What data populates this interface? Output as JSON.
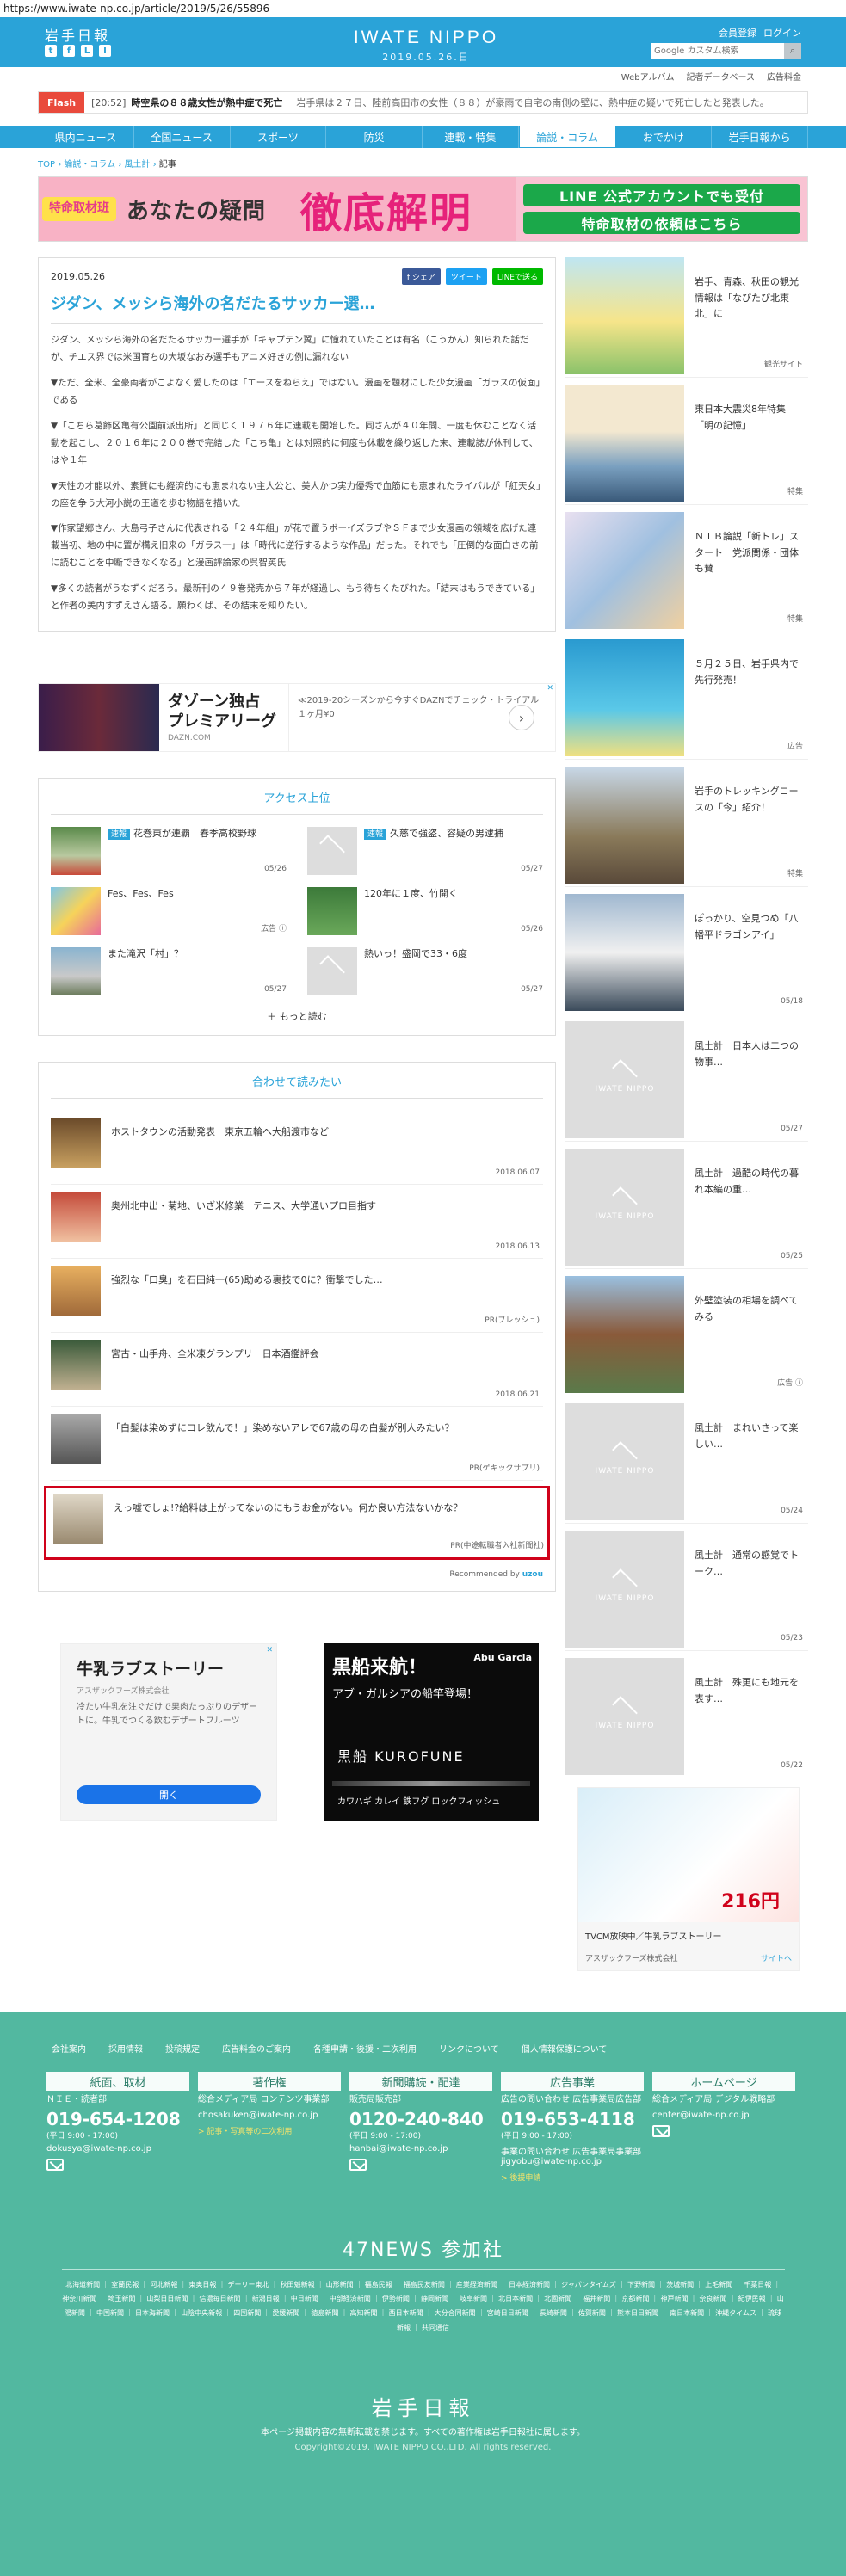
{
  "url": "https://www.iwate-np.co.jp/article/2019/5/26/55896",
  "header": {
    "logo_small": "岩手日報",
    "brand_name": "IWATE NIPPO",
    "date": "2019.05.26.日",
    "links": [
      "会員登録",
      "ログイン"
    ],
    "search_placeholder": "Google カスタム検索",
    "social": [
      "t",
      "f",
      "L",
      "I"
    ]
  },
  "subnav": [
    "Webアルバム",
    "記者データベース",
    "広告料金"
  ],
  "flash": {
    "tag": "Flash",
    "time": "[20:52]",
    "headline": "時空県の８８歳女性が熱中症で死亡",
    "body": "岩手県は２７日、陸前高田市の女性（８８）が豪雨で自宅の南側の壁に、熱中症の疑いで死亡したと発表した。"
  },
  "mainnav": [
    "県内ニュース",
    "全国ニュース",
    "スポーツ",
    "防災",
    "連載・特集",
    "論説・コラム",
    "おでかけ",
    "岩手日報から"
  ],
  "breadcrumb": [
    "TOP",
    "論説・コラム",
    "風土計",
    "記事"
  ],
  "banner": {
    "b1": "特命取材班",
    "b2": "あなたの疑問",
    "b3": "徹底解明",
    "r1": "LINE 公式アカウントでも受付",
    "r2": "特命取材の依頼はこちら"
  },
  "article": {
    "date": "2019.05.26",
    "shares": [
      "f シェア",
      "ツイート",
      "LINEで送る"
    ],
    "title": "ジダン、メッシら海外の名だたるサッカー選…",
    "paragraphs": [
      "ジダン、メッシら海外の名だたるサッカー選手が「キャプテン翼」に憧れていたことは有名（こうかん）知られた話だが、チエス界では米国育ちの大坂なおみ選手もアニメ好きの例に漏れない",
      "▼ただ、全米、全豪両者がこよなく愛したのは「エースをねらえ」ではない。漫画を題材にした少女漫画「ガラスの仮面」である",
      "▼「こちら葛飾区亀有公園前派出所」と同じく１９７６年に連載も開始した。同さんが４０年間、一度も休むことなく活動を起こし、２０１６年に２００巻で完結した「こち亀」とは対照的に何度も休載を繰り返した末、連載誌が休刊して、はや１年",
      "▼天性の才能以外、素質にも経済的にも恵まれない主人公と、美人かつ実力優秀で血筋にも恵まれたライバルが「紅天女」の座を争う大河小説の王道を歩む物語を描いた",
      "▼作家望郷さん、大島弓子さんに代表される「２４年組」が花で置うボーイズラブやＳＦまで少女漫画の領域を広げた連載当初、地の中に置が構え旧来の「ガラス一」は「時代に逆行するような作品」だった。それでも「圧倒的な面白さの前に読むことを中断できなくなる」と漫画評論家の呉智英氏",
      "▼多くの読者がうなずくだろう。最新刊の４９巻発売から７年が経過し、もう待ちくたびれた。「結末はもうできている」と作者の美内すずえさん語る。願わくば、その結末を知りたい。"
    ]
  },
  "ad_strip": {
    "title": "ダゾーン独占 プレミアリーグ",
    "domain": "DAZN.COM",
    "desc": "≪2019-20シーズンから今すぐDAZNでチェック・トライアル１ヶ月¥0",
    "arrow": "›",
    "close": "✕"
  },
  "access": {
    "title": "アクセス上位",
    "items": [
      {
        "badge": "速報",
        "text": "花巻東が連覇　春季高校野球",
        "date": "05/26"
      },
      {
        "badge": "速報",
        "text": "久慈で強盗、容疑の男逮捕",
        "date": "05/27"
      },
      {
        "badge": "",
        "text": "Fes、Fes、Fes",
        "date": "広告 ⓘ"
      },
      {
        "badge": "",
        "text": "120年に１度、竹開く",
        "date": "05/26"
      },
      {
        "badge": "",
        "text": "また滝沢「村」？",
        "date": "05/27"
      },
      {
        "badge": "",
        "text": "熱いっ！盛岡で33・6度",
        "date": "05/27"
      }
    ],
    "more": "＋ もっと読む"
  },
  "recommend": {
    "title": "合わせて読みたい",
    "items": [
      {
        "text": "ホストタウンの活動発表　東京五輪へ大船渡市など",
        "date": "2018.06.07"
      },
      {
        "text": "奥州北中出・菊地、いざ米修業　テニス、大学通いプロ目指す",
        "date": "2018.06.13"
      },
      {
        "text": "強烈な「口臭」を石田純一(65)助める裏技で0に？衝撃でした…",
        "date": "PR(ブレッシュ)"
      },
      {
        "text": "宮古・山手舟、全米凍グランプリ　日本酒鑑評会",
        "date": "2018.06.21"
      },
      {
        "text": "「白髪は染めずにコレ飲んで！」染めないアレで67歳の母の白髪が別人みたい？",
        "date": "PR(ゲキックサプリ)"
      },
      {
        "text": "えっ嘘でしょ!?給料は上がってないのにもうお金がない。何か良い方法ないかな？",
        "date": "PR(中途転職者入社新聞社)"
      }
    ],
    "powered": "Recommended by",
    "powered_brand": "uzou"
  },
  "ad_cards": {
    "milk_title": "牛乳ラブストーリー",
    "milk_sub": "アスザックフーズ株式会社",
    "milk_desc": "冷たい牛乳を注ぐだけで果肉たっぷりのデザートに。牛乳でつくる飲むデザートフルーツ",
    "milk_btn": "開く",
    "black_title": "黒船来航！",
    "black_sub": "アブ・ガルシアの船竿登場！",
    "black_brand": "Abu Garcia",
    "black_model": "黒船 KUROFUNE",
    "black_sub2": "カワハギ カレイ 鉄フグ ロックフィッシュ"
  },
  "sidebar": {
    "items": [
      {
        "text": "岩手、青森、秋田の観光情報は「なびたび北東北」に",
        "date": "観光サイト"
      },
      {
        "text": "東日本大震災8年特集「明の記憶」",
        "date": "特集"
      },
      {
        "text": "ＮＩＢ論説「新トレ」スタート　党派関係・団体も賛",
        "date": "特集"
      },
      {
        "text": "５月２５日、岩手県内で先行発売！",
        "date": "広告"
      },
      {
        "text": "岩手のトレッキングコースの「今」紹介！",
        "date": "特集"
      },
      {
        "text": "ぽっかり、空見つめ「八幡平ドラゴンアイ」",
        "date": "05/18"
      },
      {
        "text": "風土計　日本人は二つの物事…",
        "date": "05/27"
      },
      {
        "text": "風土計　過酷の時代の暮れ本編の重…",
        "date": "05/25"
      },
      {
        "text": "外壁塗装の相場を調べてみる",
        "date": "広告 ⓘ"
      },
      {
        "text": "風土計　まれいさって楽しい…",
        "date": "05/24"
      },
      {
        "text": "風土計　通常の感覚でトーク…",
        "date": "05/23"
      },
      {
        "text": "風土計　殊更にも地元を表す…",
        "date": "05/22"
      }
    ],
    "placeholder_brand": "IWATE NIPPO",
    "ad_price": "216円",
    "ad_caption": "TVCM放映中／牛乳ラブストーリー",
    "ad_company": "アスザックフーズ株式会社",
    "ad_site": "サイトへ"
  },
  "footer": {
    "links": [
      "会社案内",
      "採用情報",
      "投稿規定",
      "広告料金のご案内",
      "各種申請・後援・二次利用",
      "リンクについて",
      "個人情報保護について"
    ],
    "cols": [
      {
        "title": "紙面、取材",
        "l1": "ＮＩＥ・読者部",
        "tel": "019-654-1208",
        "hours": "(平日 9:00 - 17:00)",
        "mail": "dokusya@iwate-np.co.jp",
        "yl": ""
      },
      {
        "title": "著作権",
        "l1": "総合メディア局 コンテンツ事業部",
        "tel": "",
        "hours": "",
        "mail": "chosakuken@iwate-np.co.jp",
        "yl": "> 記事・写真等の二次利用"
      },
      {
        "title": "新聞購読・配達",
        "l1": "販売局販売部",
        "tel": "0120-240-840",
        "hours": "(平日 9:00 - 17:00)",
        "mail": "hanbai@iwate-np.co.jp",
        "yl": ""
      },
      {
        "title": "広告事業",
        "l1": "広告の問い合わせ 広告事業局広告部",
        "tel": "019-653-4118",
        "hours": "(平日 9:00 - 17:00)",
        "mail": "事業の問い合わせ 広告事業局事業部 jigyobu@iwate-np.co.jp",
        "yl": "> 後援申請"
      },
      {
        "title": "ホームページ",
        "l1": "総合メディア局 デジタル戦略部",
        "tel": "",
        "hours": "",
        "mail": "center@iwate-np.co.jp",
        "yl": ""
      }
    ],
    "news_title": "47NEWS 参加社",
    "news_list": "北海道新聞 ｜ 室蘭民報 ｜ 河北新報 ｜ 東奥日報 ｜ デーリー東北 ｜ 秋田魁新報 ｜ 山形新聞 ｜ 福島民報 ｜ 福島民友新聞 ｜ 産業経済新聞 ｜ 日本経済新聞 ｜ ジャパンタイムズ ｜ 下野新聞 ｜ 茨城新聞 ｜ 上毛新聞 ｜ 千葉日報 ｜ 神奈川新聞 ｜ 埼玉新聞 ｜ 山梨日日新聞 ｜ 信濃毎日新聞 ｜ 新潟日報 ｜ 中日新聞 ｜ 中部経済新聞 ｜ 伊勢新聞 ｜ 静岡新聞 ｜ 岐阜新聞 ｜ 北日本新聞 ｜ 北國新聞 ｜ 福井新聞 ｜ 京都新聞 ｜ 神戸新聞 ｜ 奈良新聞 ｜ 紀伊民報 ｜ 山陽新聞 ｜ 中国新聞 ｜ 日本海新聞 ｜ 山陰中央新報 ｜ 四国新聞 ｜ 愛媛新聞 ｜ 徳島新聞 ｜ 高知新聞 ｜ 西日本新聞 ｜ 大分合同新聞 ｜ 宮崎日日新聞 ｜ 長崎新聞 ｜ 佐賀新聞 ｜ 熊本日日新聞 ｜ 南日本新聞 ｜ 沖縄タイムス ｜ 琉球新報 ｜ 共同通信",
    "logo": "岩手日報",
    "note": "本ページ掲載内容の無断転載を禁じます。すべての著作権は岩手日報社に属します。",
    "copyright": "Copyright©2019. IWATE NIPPO CO.,LTD. All rights reserved."
  }
}
